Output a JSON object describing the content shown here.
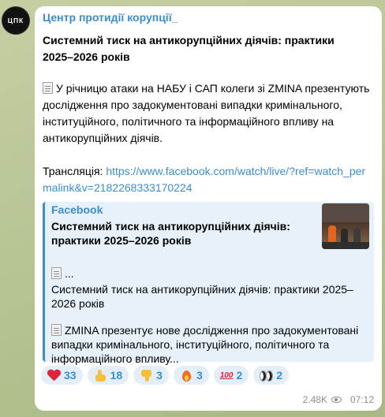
{
  "channel": {
    "avatar_text": "ЦПК",
    "name": "Центр протидії корупції_"
  },
  "post": {
    "title": "Системний тиск на антикорупційних діячів: практики 2025–2026 років",
    "body": "У річницю атаки на НАБУ і САП колеги зі ZMINA презентують дослідження про задокументовані випадки кримінального, інституційного, політичного та інформаційного впливу на антикорупційних діячів.",
    "stream_label": "Трансляція: ",
    "stream_url": "https://www.facebook.com/watch/live/?ref=watch_permalink&v=2182268333170224"
  },
  "preview": {
    "site": "Facebook",
    "title": "Системний тиск на антикорупційних діячів: практики 2025–2026 років",
    "ellipsis": "...",
    "line2": "Системний тиск на антикорупційних діячів: практики 2025–2026 років",
    "line3": "ZMINA презентує нове дослідження про задокументовані випадки кримінального, інституційного, політичного та інформаційного впливу..."
  },
  "reactions": [
    {
      "icon": "heart-icon",
      "count": "33"
    },
    {
      "icon": "thumbs-up-icon",
      "count": "18"
    },
    {
      "icon": "thumbs-down-icon",
      "count": "3"
    },
    {
      "icon": "fire-icon",
      "count": "3"
    },
    {
      "icon": "hundred-icon",
      "label": "100",
      "count": "2"
    },
    {
      "icon": "eyes-icon",
      "count": "2"
    }
  ],
  "meta": {
    "views": "2.48K",
    "time": "07:12"
  }
}
